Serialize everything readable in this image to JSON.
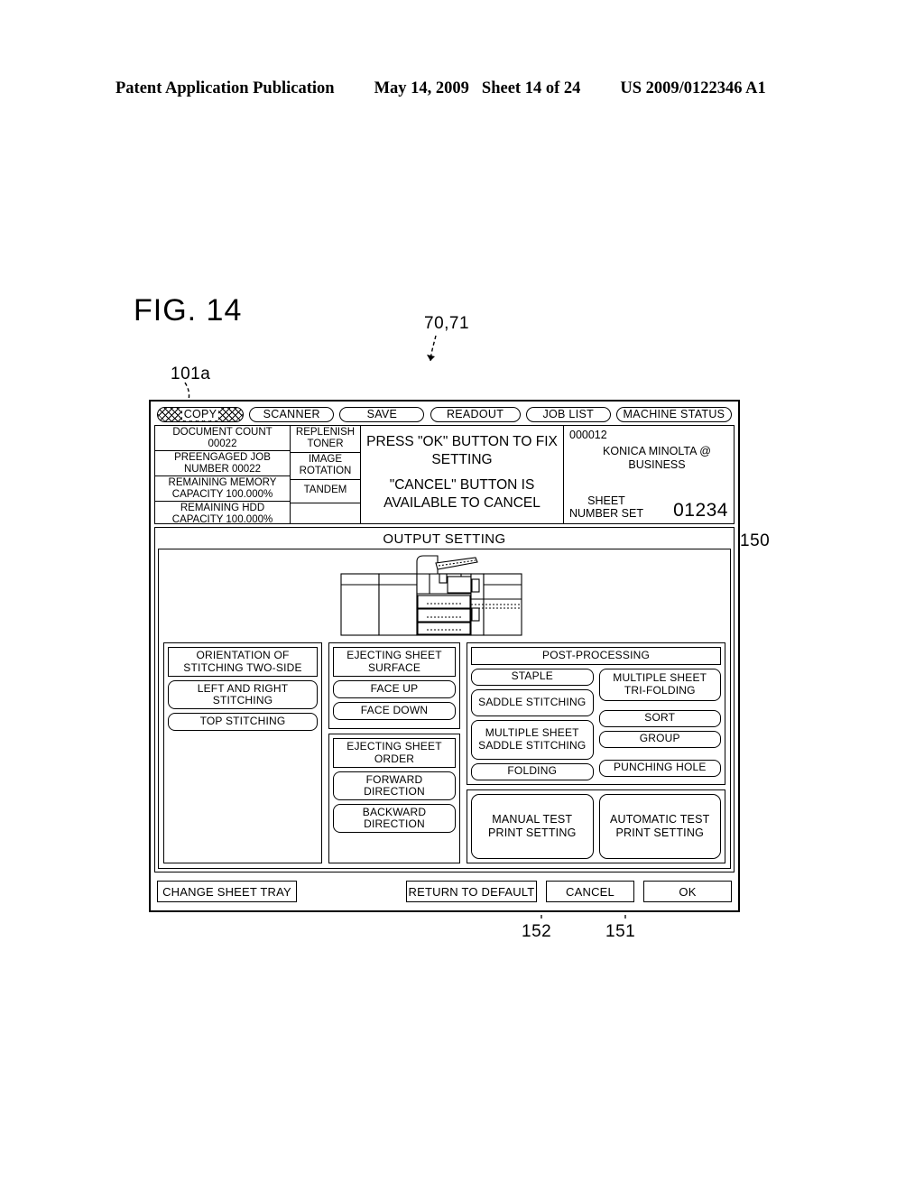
{
  "publication_header": {
    "title": "Patent Application Publication",
    "date": "May 14, 2009",
    "sheet": "Sheet 14 of 24",
    "number": "US 2009/0122346 A1"
  },
  "figure": {
    "label": "FIG. 14",
    "ref_operation_panel": "70,71",
    "ref_display": "101a",
    "ref_dialog": "150",
    "ref_cancel": "152",
    "ref_ok": "151"
  },
  "tabs": [
    {
      "label": "COPY",
      "selected": true
    },
    {
      "label": "SCANNER",
      "selected": false
    },
    {
      "label": "SAVE",
      "selected": false
    },
    {
      "label": "READOUT",
      "selected": false
    },
    {
      "label": "JOB LIST",
      "selected": false
    },
    {
      "label": "MACHINE STATUS",
      "selected": false
    }
  ],
  "status": {
    "counts": [
      {
        "label": "DOCUMENT COUNT",
        "value": "00022"
      },
      {
        "label": "PREENGAGED JOB",
        "value": "NUMBER   00022"
      },
      {
        "label": "REMAINING MEMORY",
        "value": "CAPACITY   100.000%"
      },
      {
        "label": "REMAINING HDD",
        "value": "CAPACITY   100.000%"
      }
    ],
    "modes": [
      "REPLENISH TONER",
      "IMAGE ROTATION",
      "TANDEM",
      ""
    ],
    "message_line1": "PRESS \"OK\" BUTTON TO FIX",
    "message_line2": "SETTING",
    "message_line3": "\"CANCEL\" BUTTON IS",
    "message_line4": "AVAILABLE TO CANCEL",
    "job_number": "000012",
    "brand_line1": "KONICA MINOLTA @",
    "brand_line2": "BUSINESS",
    "sheet_number_label": "SHEET\nNUMBER SET",
    "sheet_number_value": "01234"
  },
  "dialog": {
    "title": "OUTPUT SETTING",
    "stitching": {
      "header": "ORIENTATION OF STITCHING TWO-SIDE",
      "options": [
        "LEFT AND RIGHT STITCHING",
        "TOP STITCHING"
      ]
    },
    "eject_surface": {
      "header": "EJECTING SHEET SURFACE",
      "options": [
        "FACE UP",
        "FACE DOWN"
      ]
    },
    "eject_order": {
      "header": "EJECTING SHEET ORDER",
      "options": [
        "FORWARD DIRECTION",
        "BACKWARD DIRECTION"
      ]
    },
    "post_processing": {
      "header": "POST-PROCESSING",
      "left_options": [
        "STAPLE",
        "SADDLE STITCHING",
        "MULTIPLE SHEET SADDLE STITCHING",
        "FOLDING"
      ],
      "right_options": [
        "MULTIPLE SHEET TRI-FOLDING",
        "SORT",
        "GROUP",
        "PUNCHING HOLE"
      ]
    },
    "test_print": {
      "manual": "MANUAL TEST PRINT SETTING",
      "automatic": "AUTOMATIC TEST PRINT SETTING"
    }
  },
  "actions": {
    "change_sheet_tray": "CHANGE SHEET TRAY",
    "return_to_default": "RETURN TO DEFAULT",
    "cancel": "CANCEL",
    "ok": "OK"
  }
}
